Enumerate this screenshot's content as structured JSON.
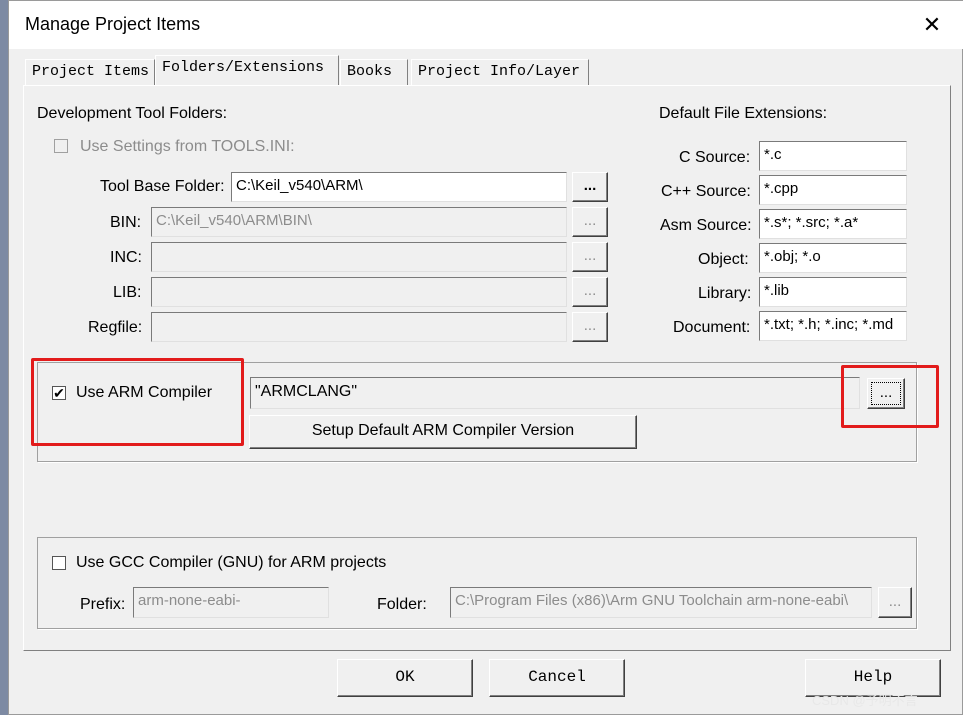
{
  "window": {
    "title": "Manage Project Items",
    "close_symbol": "✕"
  },
  "tabs": [
    "Project Items",
    "Folders/Extensions",
    "Books",
    "Project Info/Layer"
  ],
  "dev_tool_folders": {
    "heading": "Development Tool Folders:",
    "use_settings_label": "Use Settings from TOOLS.INI:",
    "tool_base_folder_label": "Tool Base Folder:",
    "tool_base_folder_value": "C:\\Keil_v540\\ARM\\",
    "bin_label": "BIN:",
    "bin_value": "C:\\Keil_v540\\ARM\\BIN\\",
    "inc_label": "INC:",
    "lib_label": "LIB:",
    "regfile_label": "Regfile:",
    "browse_label": "..."
  },
  "default_extensions": {
    "heading": "Default File Extensions:",
    "items": [
      {
        "label": "C Source:",
        "value": "*.c"
      },
      {
        "label": "C++ Source:",
        "value": "*.cpp"
      },
      {
        "label": "Asm Source:",
        "value": "*.s*; *.src; *.a*"
      },
      {
        "label": "Object:",
        "value": "*.obj; *.o"
      },
      {
        "label": "Library:",
        "value": "*.lib"
      },
      {
        "label": "Document:",
        "value": "*.txt; *.h; *.inc; *.md"
      }
    ]
  },
  "arm_compiler": {
    "checkbox_label": "Use ARM Compiler",
    "checked": true,
    "check_mark": "✔",
    "value": "\"ARMCLANG\"",
    "browse_label": "...",
    "setup_button": "Setup Default ARM Compiler Version",
    "highlight_color": "#e21b1b"
  },
  "gcc_compiler": {
    "checkbox_label": "Use GCC Compiler (GNU) for ARM projects",
    "prefix_label": "Prefix:",
    "prefix_value": "arm-none-eabi-",
    "folder_label": "Folder:",
    "folder_value": "C:\\Program Files (x86)\\Arm GNU Toolchain arm-none-eabi\\",
    "browse_label": "..."
  },
  "buttons": {
    "ok": "OK",
    "cancel": "Cancel",
    "help": "Help"
  },
  "watermark": "CSDN @予明不言"
}
